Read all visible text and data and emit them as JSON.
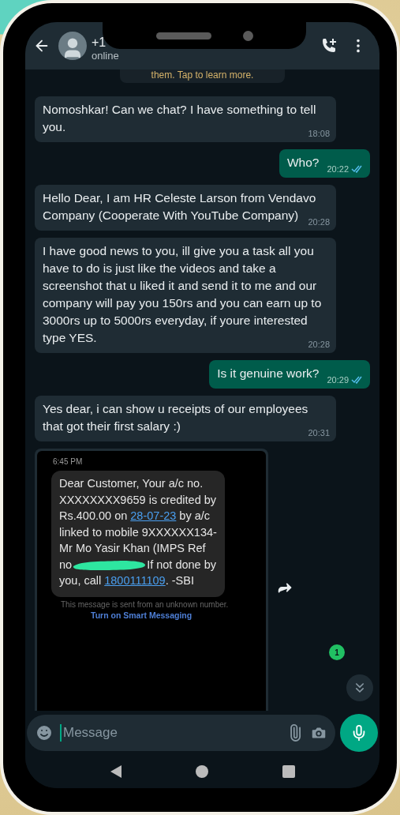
{
  "header": {
    "title": "+1",
    "status": "online"
  },
  "system_notice": "them. Tap to learn more.",
  "messages": [
    {
      "kind": "text",
      "outgoing": false,
      "text": "Nomoshkar! Can we chat? I have something to tell you.",
      "time": "18:08"
    },
    {
      "kind": "text",
      "outgoing": true,
      "text": "Who?",
      "time": "20:22",
      "read": true
    },
    {
      "kind": "text",
      "outgoing": false,
      "text": "Hello Dear, I am HR Celeste Larson from Vendavo Company (Cooperate With YouTube Company)",
      "time": "20:28"
    },
    {
      "kind": "text",
      "outgoing": false,
      "text": "I have good news to you, ill give you a task all you have to do is just like the videos and take a screenshot that u liked it and send it to me and our company will pay you 150rs and you can earn up to 3000rs up to 5000rs everyday, if youre interested type YES.",
      "time": "20:28"
    },
    {
      "kind": "text",
      "outgoing": true,
      "text": "Is it genuine work?",
      "time": "20:29",
      "read": true
    },
    {
      "kind": "text",
      "outgoing": false,
      "text": "Yes dear, i can show u receipts of our employees that got their first salary :)",
      "time": "20:31"
    },
    {
      "kind": "sms_screenshot",
      "outgoing": false,
      "sms": {
        "time": "6:45 PM",
        "segments": [
          {
            "kind": "text",
            "text": "Dear Customer, Your a/c no. XXXXXXXX9659 is credited by Rs.400.00 on "
          },
          {
            "kind": "link",
            "text": "28-07-23"
          },
          {
            "kind": "text",
            "text": " by a/c linked to mobile 9XXXXXX134-Mr  Mo Yasir Khan (IMPS Ref no"
          },
          {
            "kind": "redacted"
          },
          {
            "kind": "text",
            "text": "If not done by you, call "
          },
          {
            "kind": "link",
            "text": "1800111109"
          },
          {
            "kind": "text",
            "text": ". -SBI"
          }
        ],
        "notice": "This message is sent from an unknown number.",
        "action": "Turn on Smart Messaging"
      }
    }
  ],
  "unread_badge": "1",
  "composer": {
    "placeholder": "Message"
  }
}
